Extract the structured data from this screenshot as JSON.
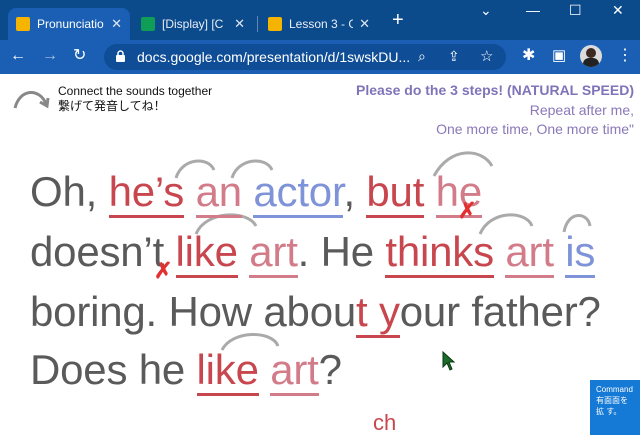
{
  "browser": {
    "tabs": [
      {
        "title": "Pronunciatio",
        "icon": "slides-icon",
        "color": "#f4b400"
      },
      {
        "title": "[Display] [C",
        "icon": "sheets-icon",
        "color": "#0f9d58"
      },
      {
        "title": "Lesson 3 - G",
        "icon": "slides-icon",
        "color": "#f4b400"
      }
    ],
    "new_tab_label": "+",
    "url": "docs.google.com/presentation/d/1swskDU..."
  },
  "slide": {
    "hint_line1": "Connect the sounds together",
    "hint_line2": "繋げて発音してね！",
    "instruction_title": "Please do the 3 steps! (NATURAL SPEED)",
    "instruction_line2": "Repeat after me,",
    "instruction_line3": "One more time, One more time\"",
    "line1": [
      "Oh, ",
      "he’s",
      " ",
      "an",
      " ",
      "actor",
      ", ",
      "but",
      " ",
      "he"
    ],
    "line2": [
      "doesn’t",
      " ",
      "like",
      " ",
      "art",
      ". He ",
      "thinks",
      " ",
      "art",
      " ",
      "is"
    ],
    "line3": [
      "boring. How abou",
      "t y",
      "our father?"
    ],
    "line4": [
      "Does he ",
      "like",
      " ",
      "art",
      "?"
    ],
    "note_ch": "ch",
    "cross_mark": "✗"
  },
  "overlay": {
    "command_text": "Command 有面面を拡 す。"
  }
}
